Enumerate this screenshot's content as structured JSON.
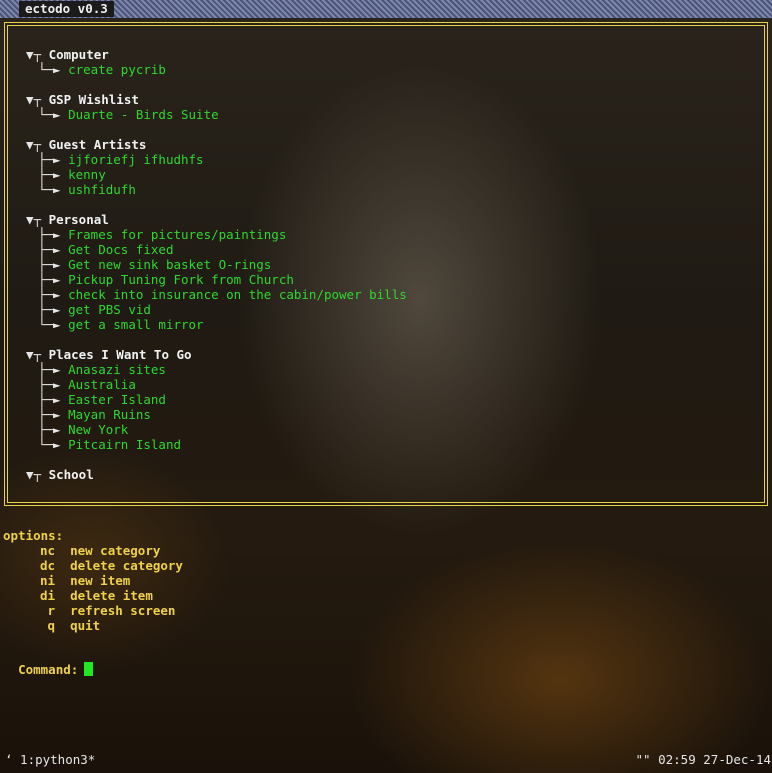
{
  "app": {
    "title": "ectodo v0.3"
  },
  "tree": {
    "categories": [
      {
        "label": "Computer",
        "items": [
          "create pycrib"
        ]
      },
      {
        "label": "GSP Wishlist",
        "items": [
          "Duarte - Birds Suite"
        ]
      },
      {
        "label": "Guest Artists",
        "items": [
          "ijforiefj ifhudhfs",
          "kenny",
          "ushfidufh"
        ]
      },
      {
        "label": "Personal",
        "items": [
          "Frames for pictures/paintings",
          "Get Docs fixed",
          "Get new sink basket O-rings",
          "Pickup Tuning Fork from Church",
          "check into insurance on the cabin/power bills",
          "get PBS vid",
          "get a small mirror"
        ]
      },
      {
        "label": "Places I Want To Go",
        "items": [
          "Anasazi sites",
          "Australia",
          "Easter Island",
          "Mayan Ruins",
          "New York",
          "Pitcairn Island"
        ]
      },
      {
        "label": "School",
        "items": []
      }
    ]
  },
  "options": {
    "header": "options:",
    "items": [
      {
        "key": "nc",
        "label": "new category"
      },
      {
        "key": "dc",
        "label": "delete category"
      },
      {
        "key": "ni",
        "label": "new item"
      },
      {
        "key": "di",
        "label": "delete item"
      },
      {
        "key": "r",
        "label": "refresh screen"
      },
      {
        "key": "q",
        "label": "quit"
      }
    ]
  },
  "command": {
    "prompt": "Command:",
    "value": ""
  },
  "statusbar": {
    "left": "‘ 1:python3*",
    "right": "\"\" 02:59 27-Dec-14"
  },
  "colors": {
    "item": "#2fd82f",
    "options": "#f0d24a",
    "border": "#e8d24a"
  }
}
